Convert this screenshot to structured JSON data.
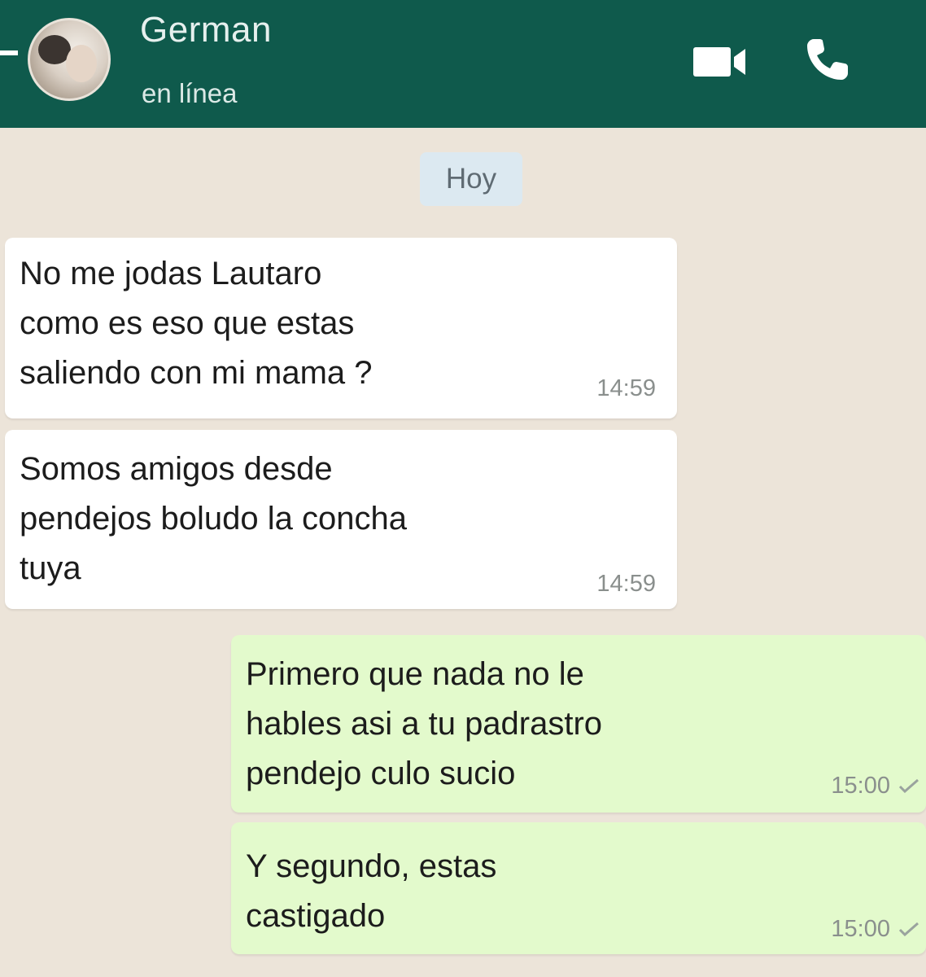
{
  "header": {
    "contact_name": "German",
    "status": "en línea",
    "icons": [
      "back-arrow-icon",
      "avatar",
      "video-call-icon",
      "phone-call-icon"
    ],
    "background_color": "#0f5a4c"
  },
  "chat": {
    "date_label": "Hoy",
    "background_color": "#ece4d9",
    "messages": [
      {
        "direction": "incoming",
        "text": "No me jodas Lautaro\ncomo es eso que estas\nsaliendo con mi mama ?",
        "time": "14:59"
      },
      {
        "direction": "incoming",
        "text": "Somos amigos desde\npendejos boludo la concha\ntuya",
        "time": "14:59"
      },
      {
        "direction": "outgoing",
        "text": "Primero que nada no le\nhables asi a tu padrastro\npendejo culo sucio",
        "time": "15:00",
        "status_icon": "check-icon"
      },
      {
        "direction": "outgoing",
        "text": "Y segundo, estas\ncastigado",
        "time": "15:00",
        "status_icon": "check-icon"
      }
    ],
    "colors": {
      "incoming_bubble": "#ffffff",
      "outgoing_bubble": "#e3facc"
    }
  }
}
